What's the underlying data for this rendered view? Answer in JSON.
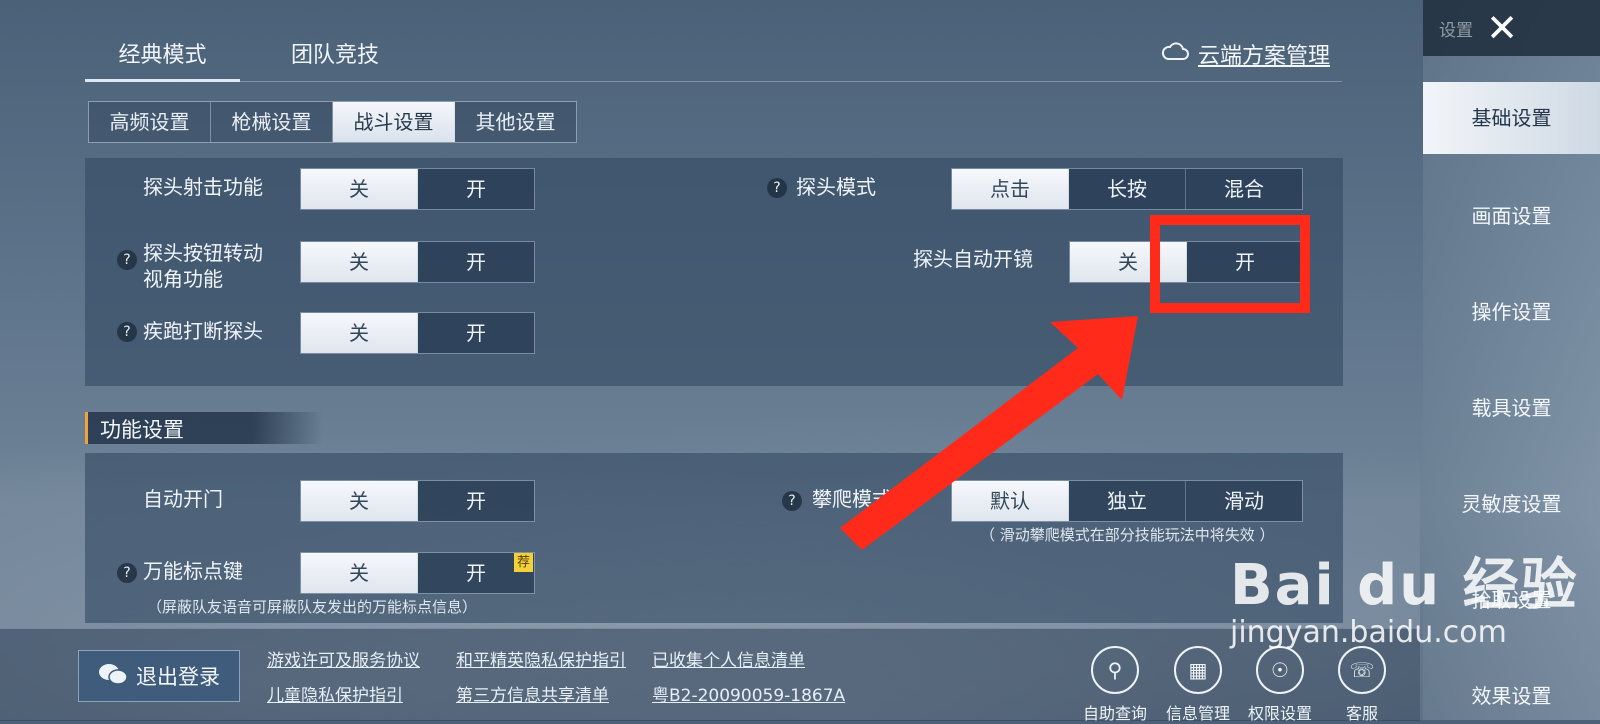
{
  "top_tabs": [
    {
      "label": "经典模式",
      "active": true
    },
    {
      "label": "团队竞技",
      "active": false
    }
  ],
  "cloud_management": "云端方案管理",
  "sub_tabs": [
    {
      "label": "高频设置"
    },
    {
      "label": "枪械设置"
    },
    {
      "label": "战斗设置",
      "active": true
    },
    {
      "label": "其他设置"
    }
  ],
  "combat": {
    "peek_shoot": {
      "label": "探头射击功能",
      "options": [
        "关",
        "开"
      ],
      "selected": "关"
    },
    "peek_mode": {
      "label": "探头模式",
      "options": [
        "点击",
        "长按",
        "混合"
      ],
      "selected": "点击"
    },
    "peek_button_rotate": {
      "label_line1": "探头按钮转动",
      "label_line2": "视角功能",
      "options": [
        "关",
        "开"
      ],
      "selected": "关"
    },
    "peek_auto_scope": {
      "label": "探头自动开镜",
      "options": [
        "关",
        "开"
      ],
      "selected": "关"
    },
    "sprint_interrupt": {
      "label": "疾跑打断探头",
      "options": [
        "关",
        "开"
      ],
      "selected": "关"
    }
  },
  "function_section": {
    "title": "功能设置",
    "auto_door": {
      "label": "自动开门",
      "options": [
        "关",
        "开"
      ],
      "selected": "关"
    },
    "climb_mode": {
      "label": "攀爬模式",
      "options": [
        "默认",
        "独立",
        "滑动"
      ],
      "selected": "默认",
      "note": "（ 滑动攀爬模式在部分技能玩法中将失效 ）"
    },
    "universal_mark": {
      "label": "万能标点键",
      "options": [
        "关",
        "开"
      ],
      "selected": "关",
      "badge": "荐",
      "note": "（屏蔽队友语音可屏蔽队友发出的万能标点信息）"
    }
  },
  "bottom": {
    "logout": "退出登录",
    "links": [
      {
        "text": "游戏许可及服务协议"
      },
      {
        "text": "和平精英隐私保护指引"
      },
      {
        "text": "已收集个人信息清单"
      },
      {
        "text": "儿童隐私保护指引"
      },
      {
        "text": "第三方信息共享清单"
      },
      {
        "text": "粤B2-20090059-1867A"
      }
    ],
    "icons": [
      {
        "label": "自助查询"
      },
      {
        "label": "信息管理"
      },
      {
        "label": "权限设置"
      },
      {
        "label": "客服"
      }
    ]
  },
  "sidebar": {
    "header": "设置",
    "items": [
      {
        "label": "基础设置",
        "active": true
      },
      {
        "label": "画面设置"
      },
      {
        "label": "操作设置"
      },
      {
        "label": "载具设置"
      },
      {
        "label": "灵敏度设置"
      },
      {
        "label": "拾取设置"
      },
      {
        "label": "效果设置"
      }
    ]
  },
  "watermark": {
    "brand": "Bai du 经验",
    "url": "jingyan.baidu.com"
  },
  "colors": {
    "accent": "#f0a33a",
    "annotation": "#ff2a1a",
    "badge": "#f2d23a"
  }
}
